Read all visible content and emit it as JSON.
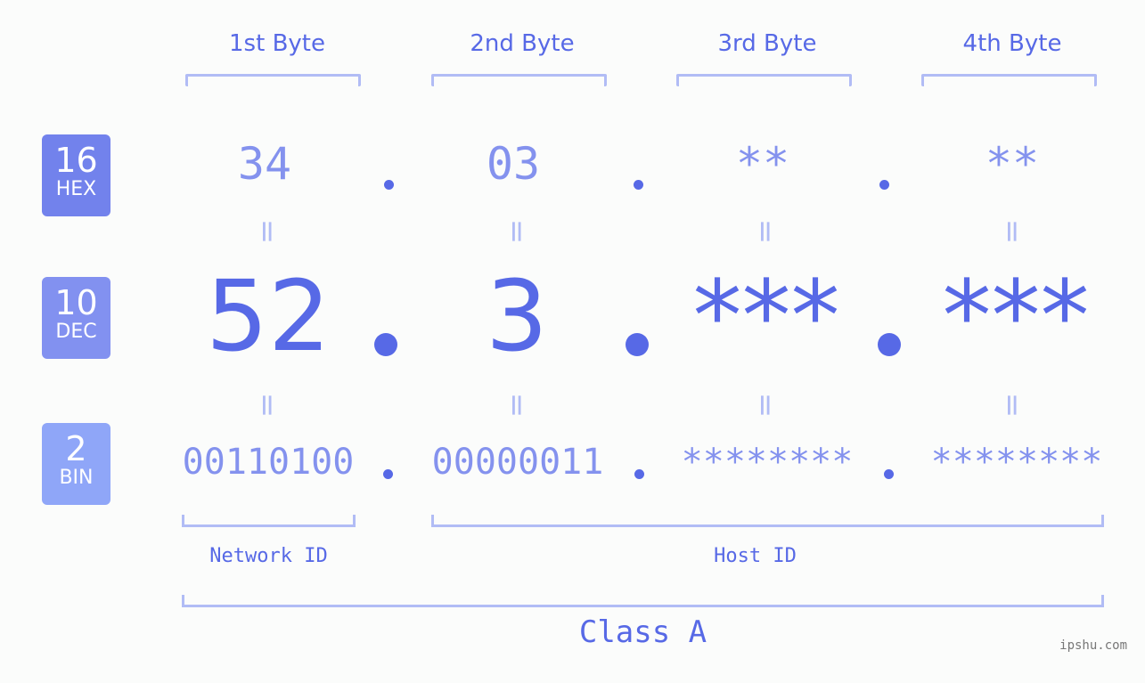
{
  "byte_headers": [
    "1st Byte",
    "2nd Byte",
    "3rd Byte",
    "4th Byte"
  ],
  "badges": [
    {
      "base": "16",
      "label": "HEX",
      "color": "#7282ec"
    },
    {
      "base": "10",
      "label": "DEC",
      "color": "#8291f0"
    },
    {
      "base": "2",
      "label": "BIN",
      "color": "#8fa6f8"
    }
  ],
  "hex": [
    "34",
    "03",
    "**",
    "**"
  ],
  "dec": [
    "52",
    "3",
    "***",
    "***"
  ],
  "bin": [
    "00110100",
    "00000011",
    "********",
    "********"
  ],
  "equals_symbol": "=",
  "network_id_label": "Network ID",
  "host_id_label": "Host ID",
  "class_label": "Class A",
  "watermark": "ipshu.com"
}
